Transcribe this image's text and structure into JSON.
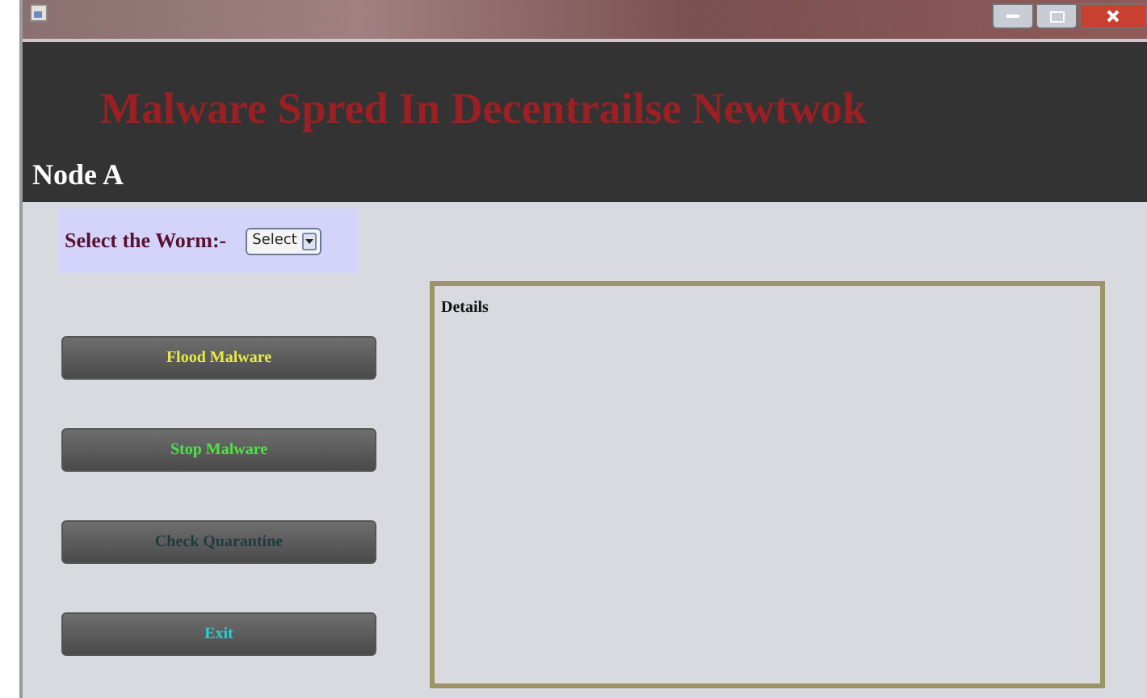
{
  "header": {
    "title": "Malware Spred In Decentrailse Newtwok",
    "node": "Node A"
  },
  "worm_select": {
    "label": "Select the Worm:-",
    "value": "Select"
  },
  "buttons": [
    {
      "label": "Flood Malware",
      "color": "#e8e84a"
    },
    {
      "label": "Stop Malware",
      "color": "#4ee04e"
    },
    {
      "label": "Check Quarantine",
      "color": "#1e3c3c"
    },
    {
      "label": "Exit",
      "color": "#2ad0d0"
    }
  ],
  "details": {
    "title": "Details"
  }
}
